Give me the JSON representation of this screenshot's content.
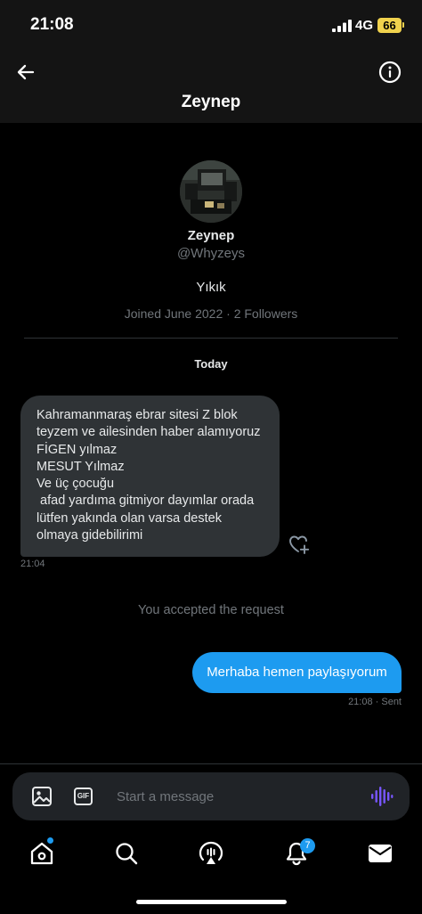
{
  "status_bar": {
    "time": "21:08",
    "network": "4G",
    "battery": "66"
  },
  "header": {
    "title": "Zeynep",
    "back_icon": "arrow-left-icon",
    "info_icon": "info-icon"
  },
  "profile": {
    "name": "Zeynep",
    "handle": "@Whyzeys",
    "bio": "Yıkık",
    "meta": "Joined June 2022 · 2 Followers"
  },
  "conversation": {
    "date_label": "Today",
    "received_message": {
      "text": "Kahramanmaraş ebrar sitesi Z blok\nteyzem ve ailesinden haber alamıyoruz\nFİGEN yılmaz\nMESUT Yılmaz\nVe üç çocuğu\n afad yardıma gitmiyor dayımlar orada\nlütfen yakında olan varsa destek\nolmaya gidebilirimi",
      "time": "21:04"
    },
    "system_note": "You accepted the request",
    "sent_message": {
      "text": "Merhaba hemen paylaşıyorum",
      "meta": "21:08 · Sent"
    }
  },
  "composer": {
    "placeholder": "Start a message",
    "gif_label": "GIF"
  },
  "nav": {
    "items": [
      "home-icon",
      "search-icon",
      "spaces-icon",
      "notifications-icon",
      "messages-icon"
    ],
    "notification_count": "7"
  },
  "colors": {
    "accent": "#1d9bf0",
    "bubble_received": "#2f3336",
    "muted_text": "#71767b",
    "voice": "#7856ff",
    "battery": "#f0d24d"
  }
}
